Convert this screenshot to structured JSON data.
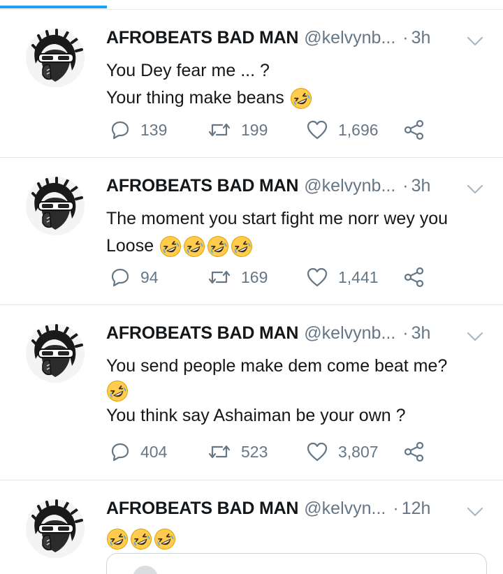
{
  "tweets": [
    {
      "name": "AFROBEATS BAD MAN",
      "handle": "@kelvynb...",
      "dot": "·",
      "time": "3h",
      "lines": [
        "You Dey fear me ... ?",
        "Your thing make beans"
      ],
      "replies": "139",
      "retweets": "199",
      "likes": "1,696"
    },
    {
      "name": "AFROBEATS BAD MAN",
      "handle": "@kelvynb...",
      "dot": "·",
      "time": "3h",
      "lines": [
        "The moment you start fight me norr wey you",
        "Loose"
      ],
      "replies": "94",
      "retweets": "169",
      "likes": "1,441"
    },
    {
      "name": "AFROBEATS BAD MAN",
      "handle": "@kelvynb...",
      "dot": "·",
      "time": "3h",
      "lines": [
        "You send people make dem come beat me?",
        "",
        "You think say Ashaiman be your own ?"
      ],
      "replies": "404",
      "retweets": "523",
      "likes": "3,807"
    },
    {
      "name": "AFROBEATS BAD MAN",
      "handle": "@kelvyn...",
      "dot": "·",
      "time": "12h",
      "lines": [
        ""
      ]
    }
  ],
  "icons": {
    "reply": "reply-icon",
    "retweet": "retweet-icon",
    "like": "like-icon",
    "share": "share-icon",
    "menu": "chevron-down-icon",
    "emoji": "rolling-on-floor-laughing-emoji"
  },
  "colors": {
    "accent": "#1da1f2",
    "secondary_text": "#657786",
    "divider": "#e1e8ed",
    "emoji_face": "#ffcc4d"
  }
}
